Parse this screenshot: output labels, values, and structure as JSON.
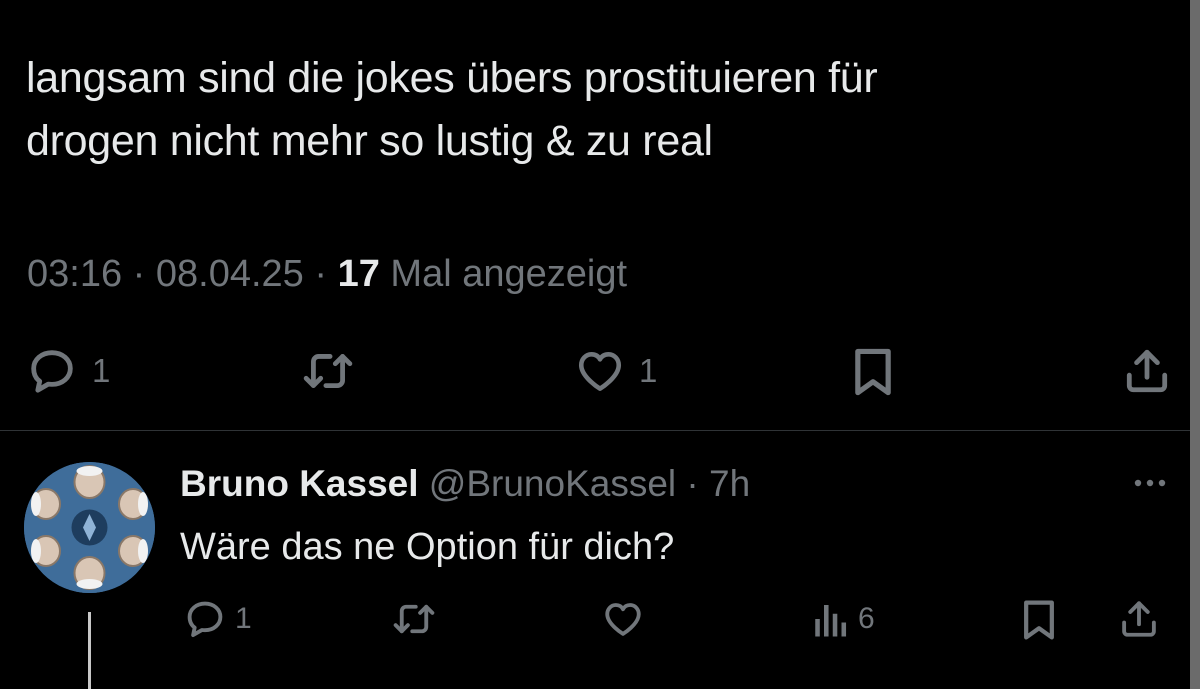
{
  "tweet": {
    "text": "langsam sind die jokes übers prostituieren für\ndrogen nicht mehr so lustig & zu real",
    "time": "03:16",
    "separator": " · ",
    "date": "08.04.25",
    "views_count": "17",
    "views_label": " Mal angezeigt",
    "actions": {
      "reply_count": "1",
      "like_count": "1"
    }
  },
  "reply": {
    "name": "Bruno Kassel",
    "handle": "@BrunoKassel",
    "separator": " · ",
    "time": "7h",
    "text": "Wäre das ne Option für dich?",
    "actions": {
      "reply_count": "1",
      "views_count": "6"
    }
  },
  "icons": {
    "reply": "reply-bubble-icon",
    "retweet": "retweet-icon",
    "like": "heart-icon",
    "bookmark": "bookmark-icon",
    "share": "share-upload-icon",
    "views": "views-bar-chart-icon",
    "more": "more-dots-icon"
  },
  "colors": {
    "background": "#000000",
    "text_primary": "#e7e9ea",
    "text_secondary": "#71767b",
    "divider": "#2f3336"
  }
}
